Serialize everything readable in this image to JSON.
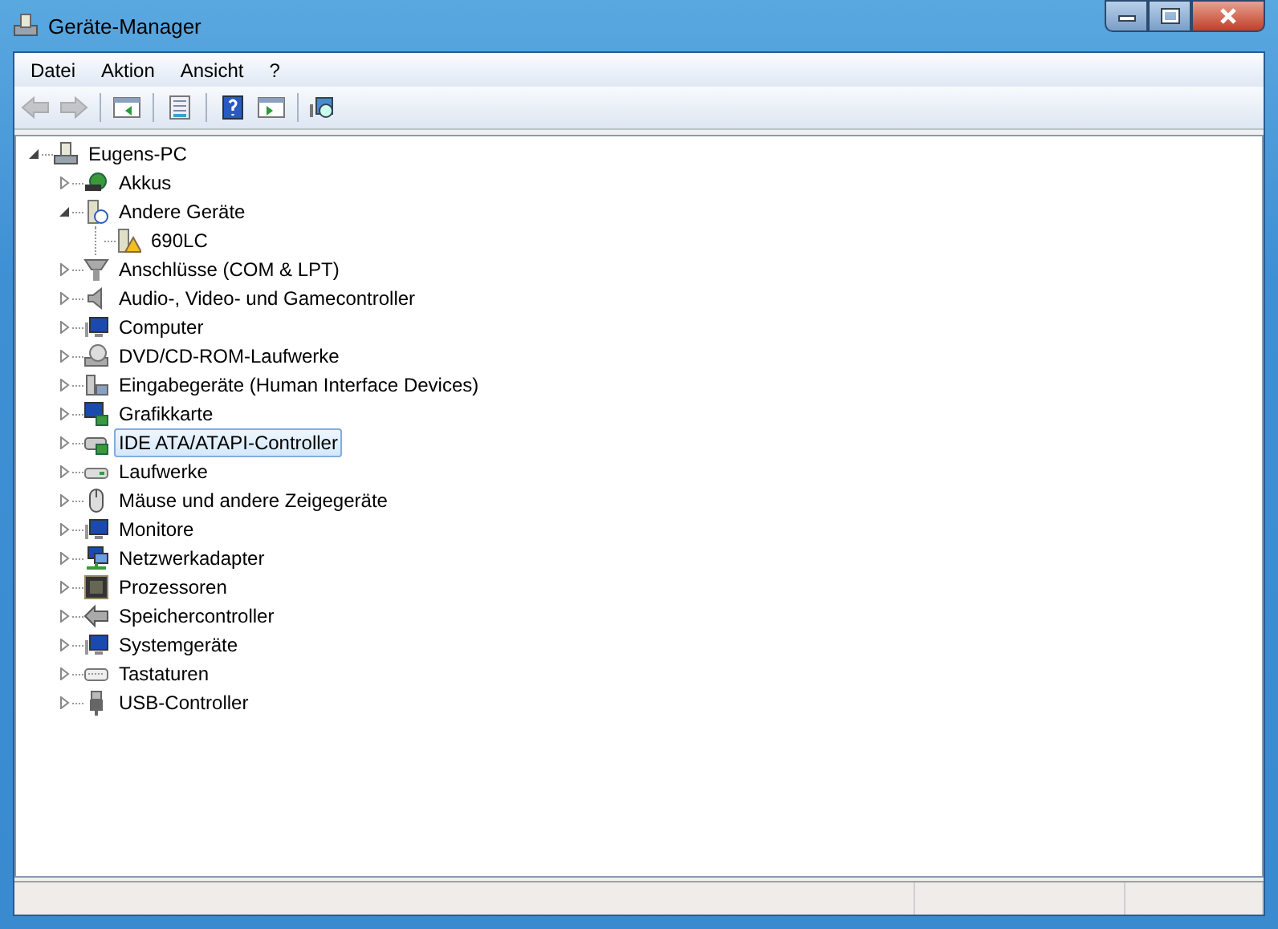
{
  "window": {
    "title": "Geräte-Manager"
  },
  "menu": [
    "Datei",
    "Aktion",
    "Ansicht",
    "?"
  ],
  "toolbar": [
    {
      "kind": "back",
      "disabled": true
    },
    {
      "kind": "forward",
      "disabled": true
    },
    {
      "kind": "sep"
    },
    {
      "kind": "tree-pane",
      "disabled": false
    },
    {
      "kind": "sep"
    },
    {
      "kind": "properties",
      "disabled": false
    },
    {
      "kind": "sep"
    },
    {
      "kind": "help",
      "disabled": false
    },
    {
      "kind": "action-pane",
      "disabled": false
    },
    {
      "kind": "sep"
    },
    {
      "kind": "scan",
      "disabled": false
    }
  ],
  "tree": [
    {
      "label": "Eugens-PC",
      "kind": "pc",
      "expanded": true,
      "selected": false,
      "children": [
        {
          "label": "Akkus",
          "kind": "battery",
          "expanded": false,
          "selected": false
        },
        {
          "label": "Andere Geräte",
          "kind": "unknown",
          "expanded": true,
          "selected": false,
          "children": [
            {
              "label": "690LC",
              "kind": "warning",
              "selected": false
            }
          ]
        },
        {
          "label": "Anschlüsse (COM & LPT)",
          "kind": "port",
          "expanded": false,
          "selected": false
        },
        {
          "label": "Audio-, Video- und Gamecontroller",
          "kind": "speaker",
          "expanded": false,
          "selected": false
        },
        {
          "label": "Computer",
          "kind": "monitor",
          "expanded": false,
          "selected": false
        },
        {
          "label": "DVD/CD-ROM-Laufwerke",
          "kind": "disc",
          "expanded": false,
          "selected": false
        },
        {
          "label": "Eingabegeräte (Human Interface Devices)",
          "kind": "input",
          "expanded": false,
          "selected": false
        },
        {
          "label": "Grafikkarte",
          "kind": "card",
          "expanded": false,
          "selected": false
        },
        {
          "label": "IDE ATA/ATAPI-Controller",
          "kind": "ide",
          "expanded": false,
          "selected": true
        },
        {
          "label": "Laufwerke",
          "kind": "drive",
          "expanded": false,
          "selected": false
        },
        {
          "label": "Mäuse und andere Zeigegeräte",
          "kind": "mouse",
          "expanded": false,
          "selected": false
        },
        {
          "label": "Monitore",
          "kind": "monitor",
          "expanded": false,
          "selected": false
        },
        {
          "label": "Netzwerkadapter",
          "kind": "network",
          "expanded": false,
          "selected": false
        },
        {
          "label": "Prozessoren",
          "kind": "chip",
          "expanded": false,
          "selected": false
        },
        {
          "label": "Speichercontroller",
          "kind": "storage",
          "expanded": false,
          "selected": false
        },
        {
          "label": "Systemgeräte",
          "kind": "monitor",
          "expanded": false,
          "selected": false
        },
        {
          "label": "Tastaturen",
          "kind": "keyboard",
          "expanded": false,
          "selected": false
        },
        {
          "label": "USB-Controller",
          "kind": "usb",
          "expanded": false,
          "selected": false
        }
      ]
    }
  ]
}
